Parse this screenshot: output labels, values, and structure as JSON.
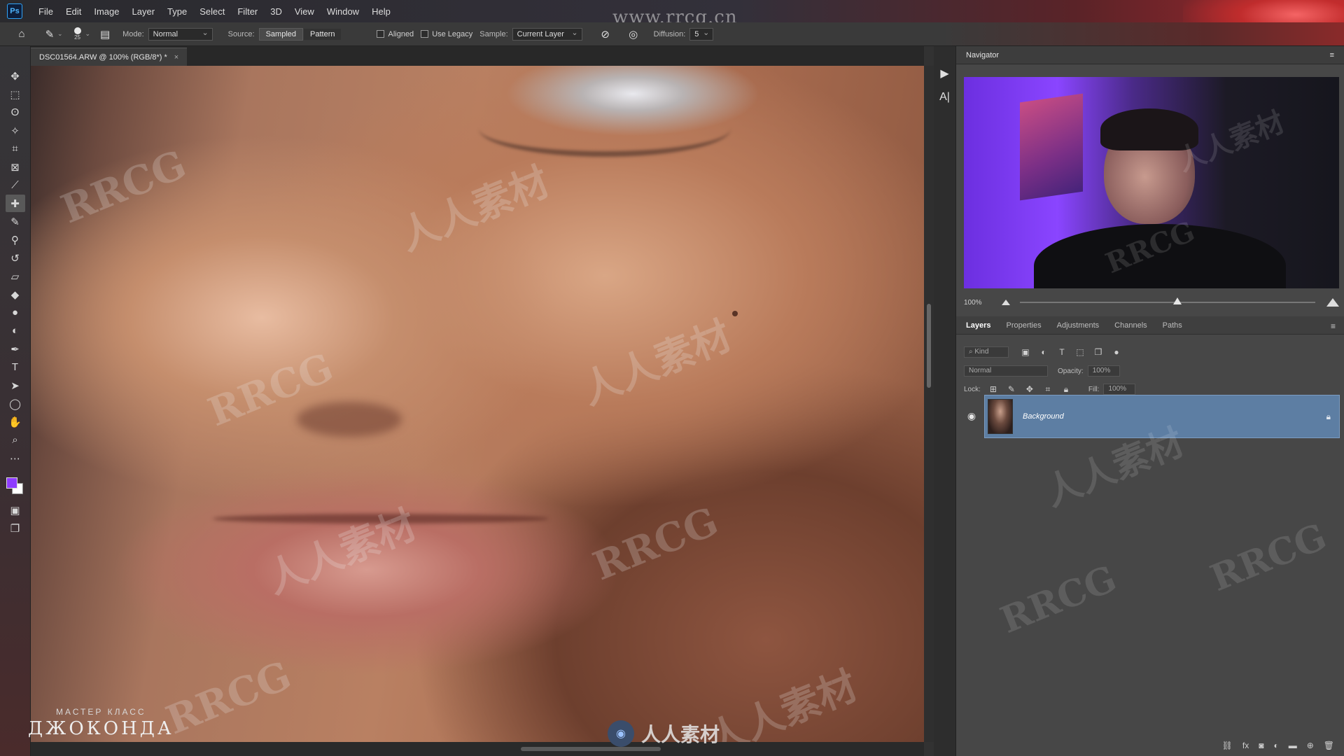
{
  "app": {
    "logo": "Ps",
    "watermark_top": "www.rrcg.cn"
  },
  "menu": [
    "File",
    "Edit",
    "Image",
    "Layer",
    "Type",
    "Select",
    "Filter",
    "3D",
    "View",
    "Window",
    "Help"
  ],
  "options": {
    "brush_size": "25",
    "mode_label": "Mode:",
    "mode_value": "Normal",
    "source_label": "Source:",
    "source_sampled": "Sampled",
    "source_pattern": "Pattern",
    "aligned_label": "Aligned",
    "use_legacy_label": "Use Legacy",
    "sample_label": "Sample:",
    "sample_value": "Current Layer",
    "diffusion_label": "Diffusion:",
    "diffusion_value": "5"
  },
  "document": {
    "tab_title": "DSC01564.ARW @ 100% (RGB/8*) *",
    "close": "×"
  },
  "tools": [
    "move-tool",
    "marquee-tool",
    "lasso-tool",
    "magic-wand-tool",
    "crop-tool",
    "frame-tool",
    "eyedropper-tool",
    "healing-brush-tool",
    "brush-tool",
    "clone-stamp-tool",
    "history-brush-tool",
    "eraser-tool",
    "paint-bucket-tool",
    "blur-tool",
    "dodge-tool",
    "pen-tool",
    "type-tool",
    "path-selection-tool",
    "shape-tool",
    "hand-tool",
    "zoom-tool",
    "more-tools"
  ],
  "colors": {
    "foreground": "#8e3cff",
    "background": "#ffffff",
    "layer_selected": "#5d7ea3"
  },
  "canvas": {
    "watermarks": [
      "RRCG",
      "人人素材",
      "RRCG",
      "人人素材",
      "RRCG",
      "人人素材",
      "RRCG",
      "人人素材"
    ],
    "brand_sub": "МАСТЕР КЛАСС",
    "brand_main": "ДЖОКОНДА",
    "logo_text": "人人素材"
  },
  "navigator": {
    "title": "Navigator",
    "zoom": "100%"
  },
  "layers_panel": {
    "tabs": [
      "Layers",
      "Properties",
      "Adjustments",
      "Channels",
      "Paths"
    ],
    "kind_placeholder": "Kind",
    "blend_mode": "Normal",
    "opacity_label": "Opacity:",
    "opacity_value": "100%",
    "lock_label": "Lock:",
    "fill_label": "Fill:",
    "fill_value": "100%",
    "layers": [
      {
        "name": "Background",
        "locked": true,
        "visible": true
      }
    ]
  }
}
